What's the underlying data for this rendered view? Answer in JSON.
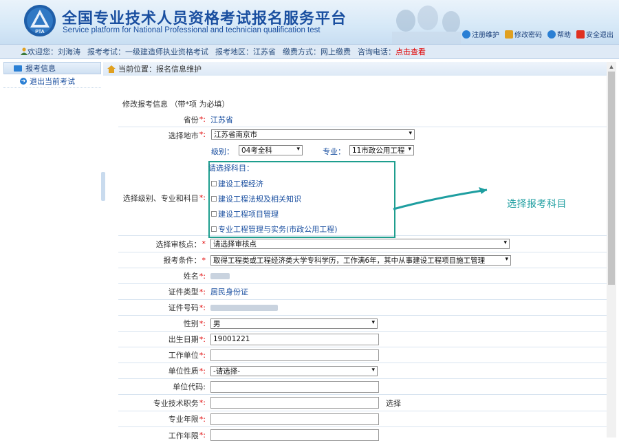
{
  "header": {
    "title_cn": "全国专业技术人员资格考试报名服务平台",
    "title_en": "Service platform for National Professional and technician qualification test",
    "logo_text": "PTA",
    "links": [
      {
        "label": "注册维护",
        "icon": "user-edit-icon",
        "color": "#2a7fd4"
      },
      {
        "label": "修改密码",
        "icon": "lock-icon",
        "color": "#e0a020"
      },
      {
        "label": "帮助",
        "icon": "help-icon",
        "color": "#2a7fd4"
      },
      {
        "label": "安全退出",
        "icon": "power-icon",
        "color": "#e03020"
      }
    ]
  },
  "infobar": {
    "welcome": "欢迎您：刘海涛",
    "exam": "报考考试：一级建造师执业资格考试",
    "region": "报考地区：江苏省",
    "payment": "缴费方式：网上缴费",
    "consult_label": "咨询电话：",
    "consult_link": "点击查看"
  },
  "sidebar": {
    "header": "报考信息",
    "items": [
      {
        "label": "退出当前考试"
      }
    ]
  },
  "breadcrumb": "当前位置：报名信息维护",
  "form": {
    "title": "修改报考信息 （带*项 为必填）",
    "province": {
      "label": "省份",
      "value": "江苏省"
    },
    "city": {
      "label": "选择地市",
      "value": "江苏省南京市"
    },
    "level": {
      "label": "级别：",
      "value": "04考全科"
    },
    "major": {
      "label": "专业：",
      "value": "11市政公用工程"
    },
    "subjects": {
      "label": "选择级别、专业和科目",
      "prompt": "请选择科目：",
      "items": [
        "建设工程经济",
        "建设工程法规及相关知识",
        "建设工程项目管理",
        "专业工程管理与实务(市政公用工程)"
      ]
    },
    "review_point": {
      "label": "选择审核点：",
      "value": "请选择审核点"
    },
    "condition": {
      "label": "报考条件：",
      "value": "取得工程类或工程经济类大学专科学历，工作满6年，其中从事建设工程项目施工管理"
    },
    "name": {
      "label": "姓名"
    },
    "id_type": {
      "label": "证件类型",
      "value": "居民身份证"
    },
    "id_number": {
      "label": "证件号码"
    },
    "gender": {
      "label": "性别",
      "value": "男"
    },
    "birth": {
      "label": "出生日期",
      "value": "19001221"
    },
    "work_unit": {
      "label": "工作单位"
    },
    "unit_nature": {
      "label": "单位性质",
      "value": "-请选择-"
    },
    "unit_code": {
      "label": "单位代码"
    },
    "tech_title": {
      "label": "专业技术职务",
      "action": "选择"
    },
    "major_years": {
      "label": "专业年限"
    },
    "work_years": {
      "label": "工作年限"
    }
  },
  "annotation": "选择报考科目"
}
